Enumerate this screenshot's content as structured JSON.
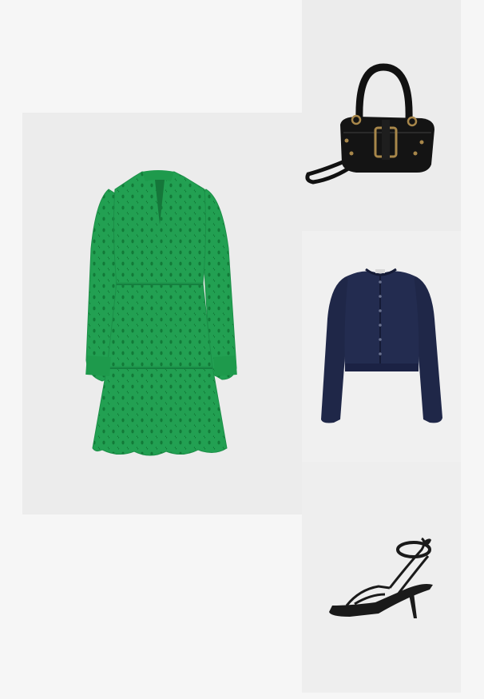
{
  "items": [
    {
      "id": "dress",
      "icon": "dress-product-image",
      "color": "#22a052"
    },
    {
      "id": "bag",
      "icon": "handbag-product-image",
      "color": "#151515"
    },
    {
      "id": "cardigan",
      "icon": "cardigan-product-image",
      "color": "#1f2748"
    },
    {
      "id": "sandal",
      "icon": "sandal-product-image",
      "color": "#1a1a1a"
    }
  ],
  "colors": {
    "page_background": "#f6f6f6",
    "tile_background": "#ececec"
  }
}
